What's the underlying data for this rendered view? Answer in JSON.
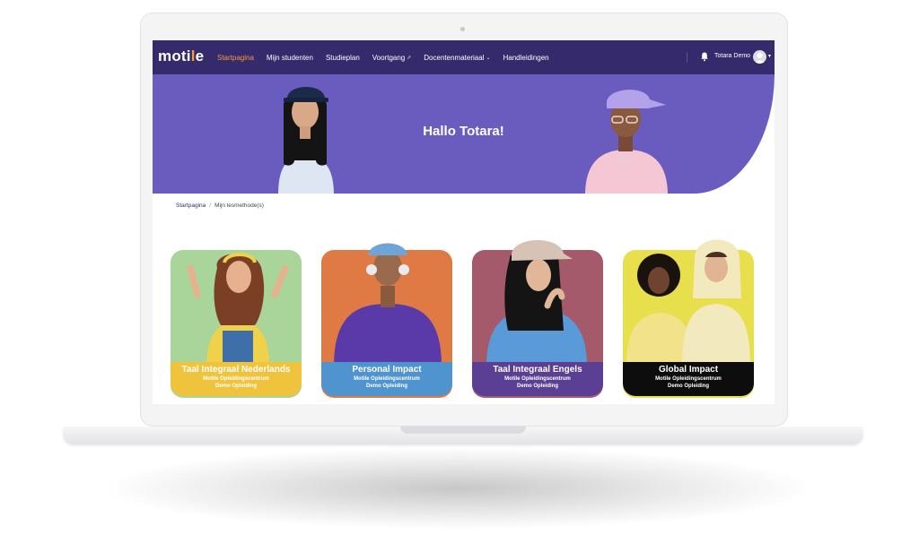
{
  "brand": {
    "logo_pre": "moti",
    "logo_accent": "l",
    "logo_post": "e"
  },
  "nav": {
    "items": [
      {
        "label": "Startpagina",
        "active": true
      },
      {
        "label": "Mijn studenten"
      },
      {
        "label": "Studieplan"
      },
      {
        "label": "Voortgang",
        "external": true
      },
      {
        "label": "Docentenmateriaal",
        "dropdown": true
      },
      {
        "label": "Handleidingen"
      }
    ],
    "user_name": "Totara Demo"
  },
  "banner": {
    "title": "Hallo Totara!"
  },
  "breadcrumb": {
    "home": "Startpagina",
    "separator": "/",
    "current": "Mijn lesmethode(s)"
  },
  "courses": [
    {
      "title": "Taal Integraal Nederlands",
      "line1": "Motile Opleidingscentrum",
      "line2": "Demo Opleiding",
      "bg": "#a9d59a",
      "label_color": "#f0c33c"
    },
    {
      "title": "Personal Impact",
      "line1": "Motile Opleidingscentrum",
      "line2": "Demo Opleiding",
      "bg": "#e07a45",
      "label_color": "#4f94cf"
    },
    {
      "title": "Taal Integraal Engels",
      "line1": "Motile Opleidingscentrum",
      "line2": "Demo Opleiding",
      "bg": "#a45a6a",
      "label_color": "#5a3f94"
    },
    {
      "title": "Global Impact",
      "line1": "Motile Opleidingscentrum",
      "line2": "Demo Opleiding",
      "bg": "#e7df4b",
      "label_color": "#0d0d0d"
    }
  ],
  "colors": {
    "nav_bg": "#352a6c",
    "banner_bg": "#6a5bbf",
    "accent": "#f39a3c"
  },
  "icons": {
    "bell": "bell-icon",
    "external": "external-link-icon",
    "caret": "chevron-down-icon"
  }
}
